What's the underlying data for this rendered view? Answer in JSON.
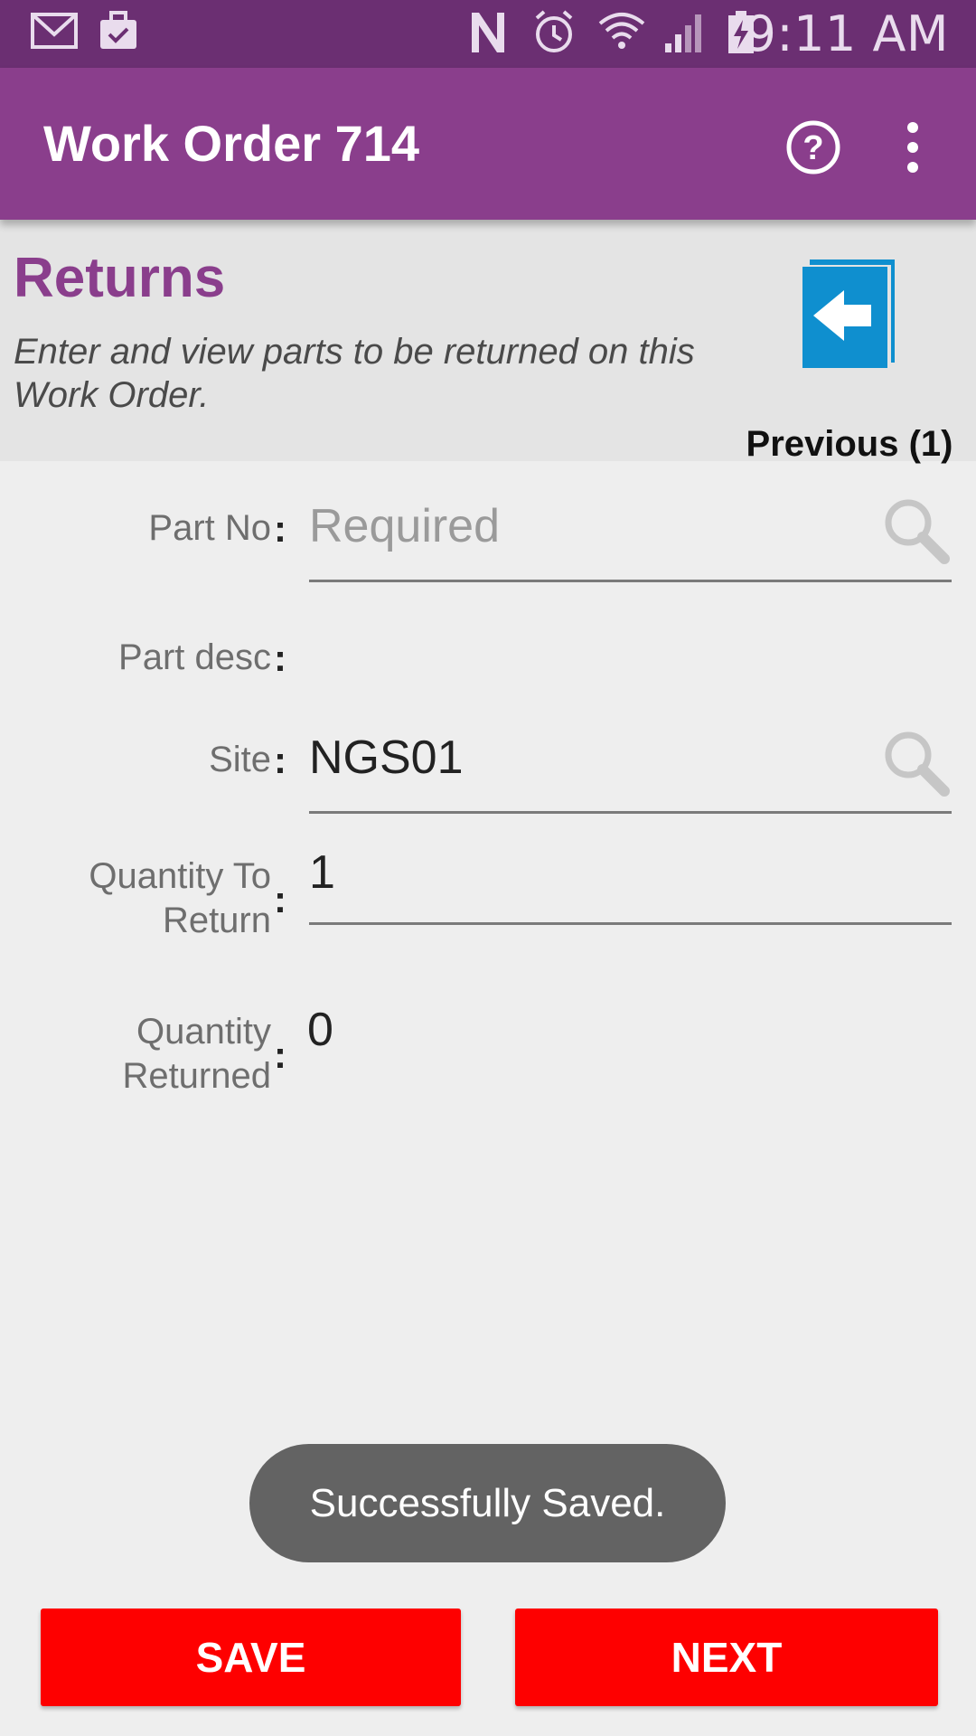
{
  "status_bar": {
    "time": "9:11 AM",
    "left_icons": [
      "gmail-icon",
      "briefcase-check-icon"
    ],
    "right_icons": [
      "nfc-icon",
      "alarm-icon",
      "wifi-icon",
      "signal-icon",
      "battery-charging-icon"
    ]
  },
  "app_bar": {
    "title": "Work Order 714",
    "help_icon": "help-circle-icon",
    "overflow_icon": "more-vert-icon",
    "color": "#8a3e8c"
  },
  "header": {
    "title": "Returns",
    "description": "Enter and view parts to be returned on this Work Order.",
    "previous_label": "Previous (1)",
    "previous_icon": "back-arrow-icon"
  },
  "form": {
    "part_no": {
      "label": "Part No",
      "placeholder": "Required",
      "value": ""
    },
    "part_desc": {
      "label": "Part desc",
      "value": ""
    },
    "site": {
      "label": "Site",
      "value": "NGS01"
    },
    "quantity_to_return": {
      "label": "Quantity To Return",
      "value": "1"
    },
    "quantity_returned": {
      "label": "Quantity Returned",
      "value": "0"
    },
    "separator": ":"
  },
  "toast": {
    "message": "Successfully Saved."
  },
  "buttons": {
    "save": "SAVE",
    "next": "NEXT",
    "color": "#fe0000"
  }
}
